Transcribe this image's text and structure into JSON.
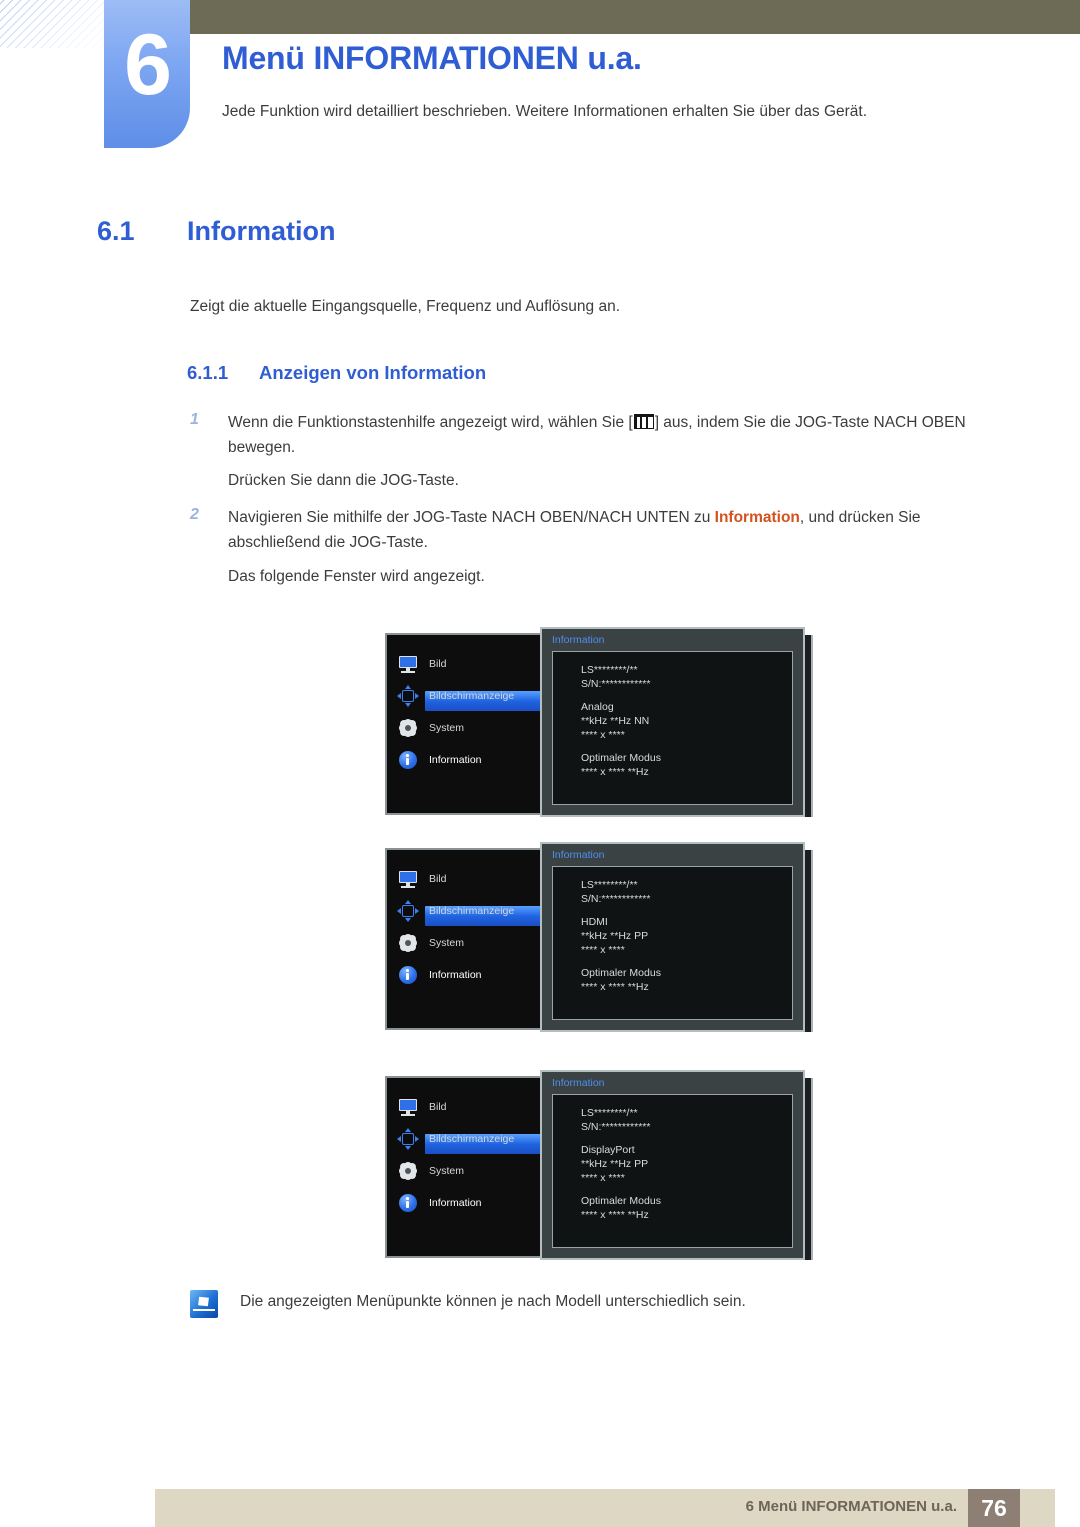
{
  "chapter": {
    "number": "6",
    "title": "Menü INFORMATIONEN u.a.",
    "subtitle": "Jede Funktion wird detailliert beschrieben. Weitere Informationen erhalten Sie über das Gerät."
  },
  "section": {
    "number": "6.1",
    "title": "Information",
    "lead": "Zeigt die aktuelle Eingangsquelle, Frequenz und Auflösung an."
  },
  "subsection": {
    "number": "6.1.1",
    "title": "Anzeigen von Information"
  },
  "steps": [
    {
      "num": "1",
      "text_before": "Wenn die Funktionstastenhilfe angezeigt wird, wählen Sie [",
      "icon": "menu-bars-icon",
      "text_after": "] aus, indem Sie die JOG-Taste NACH OBEN bewegen.",
      "extra": "Drücken Sie dann die JOG-Taste."
    },
    {
      "num": "2",
      "text_before": "Navigieren Sie mithilfe der JOG-Taste NACH OBEN/NACH UNTEN zu ",
      "highlight": "Information",
      "text_after": ", und drücken Sie abschließend die JOG-Taste.",
      "extra": "Das folgende Fenster wird angezeigt."
    }
  ],
  "osd_menu_items": [
    {
      "label": "Bild",
      "icon": "monitor-icon",
      "selected": false
    },
    {
      "label": "Bildschirmanzeige",
      "icon": "screen-adjust-icon",
      "selected": false
    },
    {
      "label": "System",
      "icon": "gear-icon",
      "selected": false
    },
    {
      "label": "Information",
      "icon": "info-icon",
      "selected": true
    }
  ],
  "osd_panels": [
    {
      "title": "Information",
      "model": "LS********/**",
      "serial": "S/N:************",
      "source": "Analog",
      "timing": "**kHz **Hz NN",
      "resolution": "**** x ****",
      "optimal_label": "Optimaler Modus",
      "optimal_value": "**** x **** **Hz"
    },
    {
      "title": "Information",
      "model": "LS********/**",
      "serial": "S/N:************",
      "source": "HDMI",
      "timing": "**kHz **Hz PP",
      "resolution": "**** x ****",
      "optimal_label": "Optimaler Modus",
      "optimal_value": "**** x **** **Hz"
    },
    {
      "title": "Information",
      "model": "LS********/**",
      "serial": "S/N:************",
      "source": "DisplayPort",
      "timing": "**kHz **Hz PP",
      "resolution": "**** x ****",
      "optimal_label": "Optimaler Modus",
      "optimal_value": "**** x **** **Hz"
    }
  ],
  "note": {
    "icon": "note-pen-icon",
    "text": "Die angezeigten Menüpunkte können je nach Modell unterschiedlich sein."
  },
  "footer": {
    "text": "6 Menü INFORMATIONEN u.a.",
    "page": "76"
  },
  "colors": {
    "accent_blue": "#2f5dd3",
    "highlight_orange": "#d4521e",
    "header_olive": "#6d6a55",
    "footer_beige": "#ddd7c4",
    "footer_page_brown": "#8d7f74",
    "osd_select_blue": "#1f63e0"
  }
}
